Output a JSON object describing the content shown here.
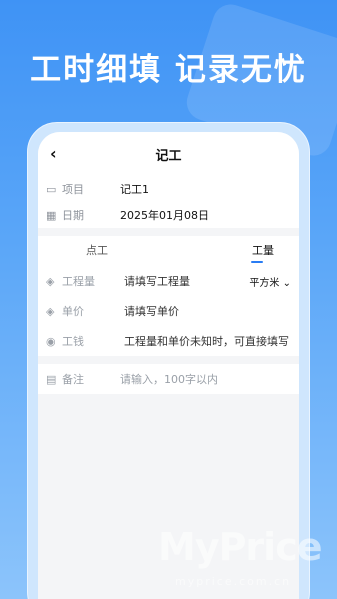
{
  "headline": "工时细填 记录无忧",
  "nav": {
    "back_icon": "chevron-left-icon",
    "title": "记工"
  },
  "info": {
    "project_label": "项目",
    "project_value": "记工1",
    "date_label": "日期",
    "date_value": "2025年01月08日"
  },
  "tabs": [
    {
      "label": "点工"
    },
    {
      "label": "工量"
    }
  ],
  "form": {
    "quantity_label": "工程量",
    "quantity_placeholder": "请填写工程量",
    "unit": "平方米",
    "price_label": "单价",
    "price_placeholder": "请填写单价",
    "wage_label": "工钱",
    "wage_hint": "工程量和单价未知时，可直接填写"
  },
  "note": {
    "label": "备注",
    "placeholder": "请输入，100字以内"
  },
  "watermark": {
    "brand": "MyPrice",
    "sub": "myprice.com.cn"
  }
}
